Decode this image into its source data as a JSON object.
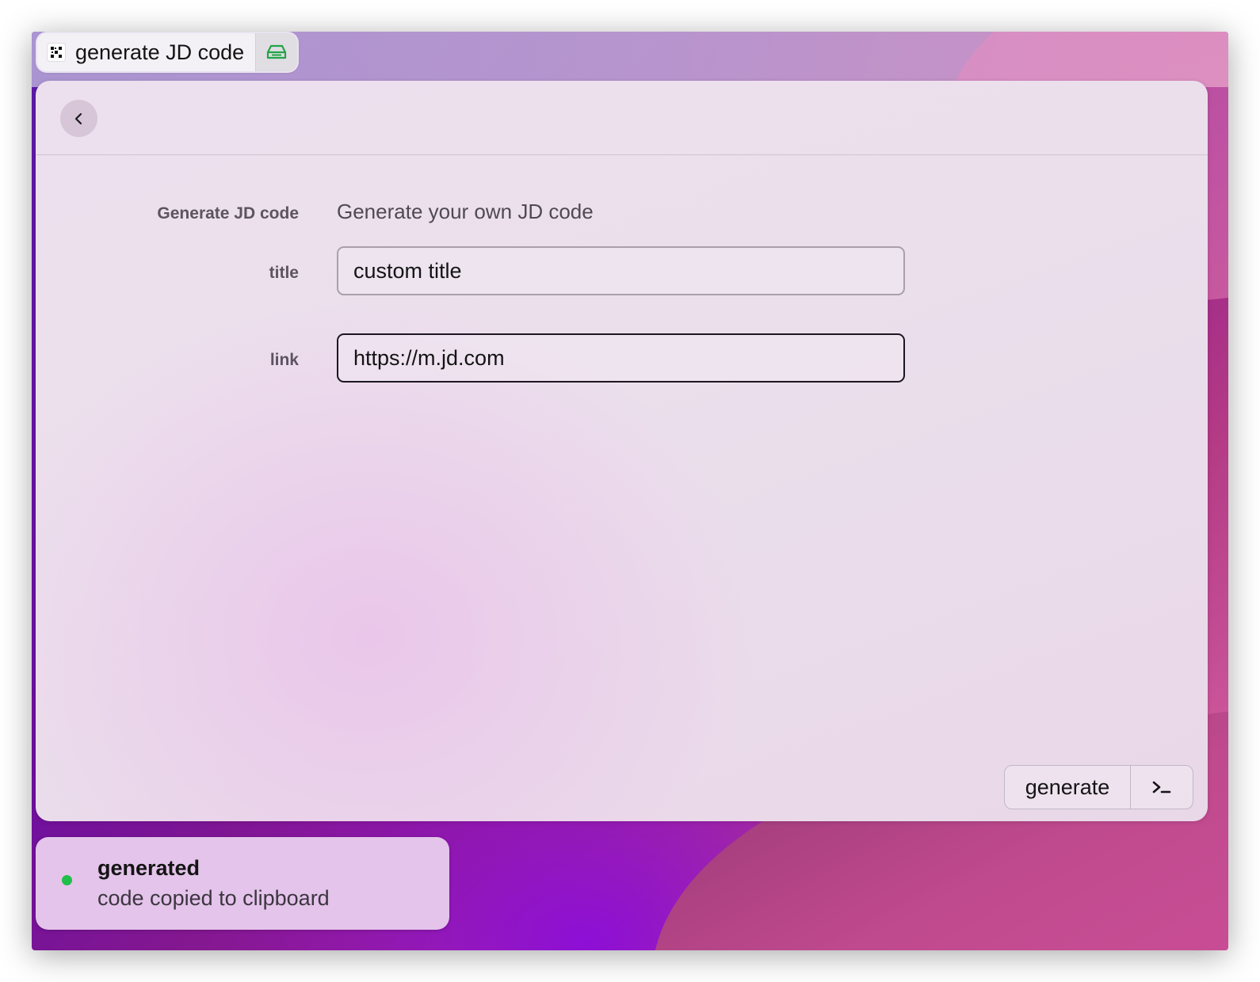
{
  "window": {
    "title": "generate JD code",
    "app_icon": "qr-grid-icon",
    "drive_icon": "drive-icon"
  },
  "header": {
    "back_icon": "chevron-left-icon"
  },
  "form": {
    "section_label": "Generate JD code",
    "section_description": "Generate your own JD code",
    "fields": [
      {
        "label": "title",
        "value": "custom title"
      },
      {
        "label": "link",
        "value": "https://m.jd.com"
      }
    ]
  },
  "actions": {
    "primary_label": "generate",
    "secondary_icon": "terminal-icon"
  },
  "toast": {
    "title": "generated",
    "message": "code copied to clipboard",
    "status_color": "#1fbf4a"
  },
  "colors": {
    "accent_green": "#22a447",
    "status_green": "#1fbf4a"
  }
}
